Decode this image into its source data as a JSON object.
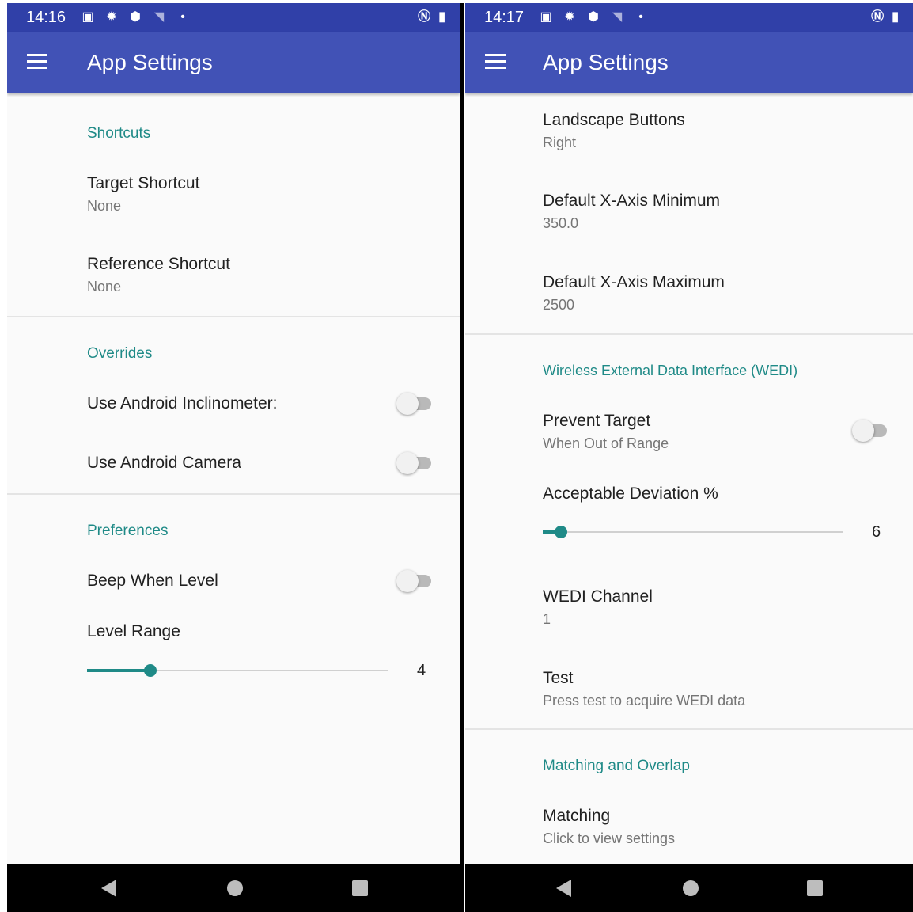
{
  "left": {
    "status": {
      "time": "14:16"
    },
    "appbar": {
      "title": "App Settings"
    },
    "shortcuts": {
      "header": "Shortcuts",
      "target_title": "Target Shortcut",
      "target_summary": "None",
      "reference_title": "Reference Shortcut",
      "reference_summary": "None"
    },
    "overrides": {
      "header": "Overrides",
      "inclinometer_label": "Use Android Inclinometer:",
      "inclinometer_on": false,
      "camera_label": "Use Android Camera",
      "camera_on": false
    },
    "preferences": {
      "header": "Preferences",
      "beep_label": "Beep When Level",
      "beep_on": false,
      "level_range_label": "Level Range",
      "level_range_value": "4",
      "level_range_fraction": 0.21
    }
  },
  "right": {
    "status": {
      "time": "14:17"
    },
    "appbar": {
      "title": "App Settings"
    },
    "display": {
      "landscape_title": "Landscape Buttons",
      "landscape_summary": "Right",
      "xmin_title": "Default X-Axis Minimum",
      "xmin_summary": "350.0",
      "xmax_title": "Default X-Axis Maximum",
      "xmax_summary": "2500"
    },
    "wedi": {
      "header": "Wireless External Data Interface (WEDI)",
      "prevent_title": "Prevent Target",
      "prevent_summary": "When Out of Range",
      "prevent_on": false,
      "deviation_label": "Acceptable Deviation %",
      "deviation_value": "6",
      "deviation_fraction": 0.06,
      "channel_title": "WEDI Channel",
      "channel_summary": "1",
      "test_title": "Test",
      "test_summary": "Press test to acquire WEDI data"
    },
    "matching": {
      "header": "Matching and Overlap",
      "matching_title": "Matching",
      "matching_summary": "Click to view settings"
    }
  },
  "icons": {
    "status_left": [
      "image-icon",
      "gear-icon",
      "shield-icon",
      "wifi-icon",
      "dot-icon"
    ],
    "status_right": [
      "nfc-icon",
      "battery-icon"
    ],
    "nav": [
      "back-icon",
      "home-icon",
      "recents-icon"
    ]
  },
  "colors": {
    "status_bar": "#3040a8",
    "app_bar": "#4152b6",
    "accent": "#1f8a87",
    "background": "#fafafa",
    "nav_bar": "#000000"
  }
}
